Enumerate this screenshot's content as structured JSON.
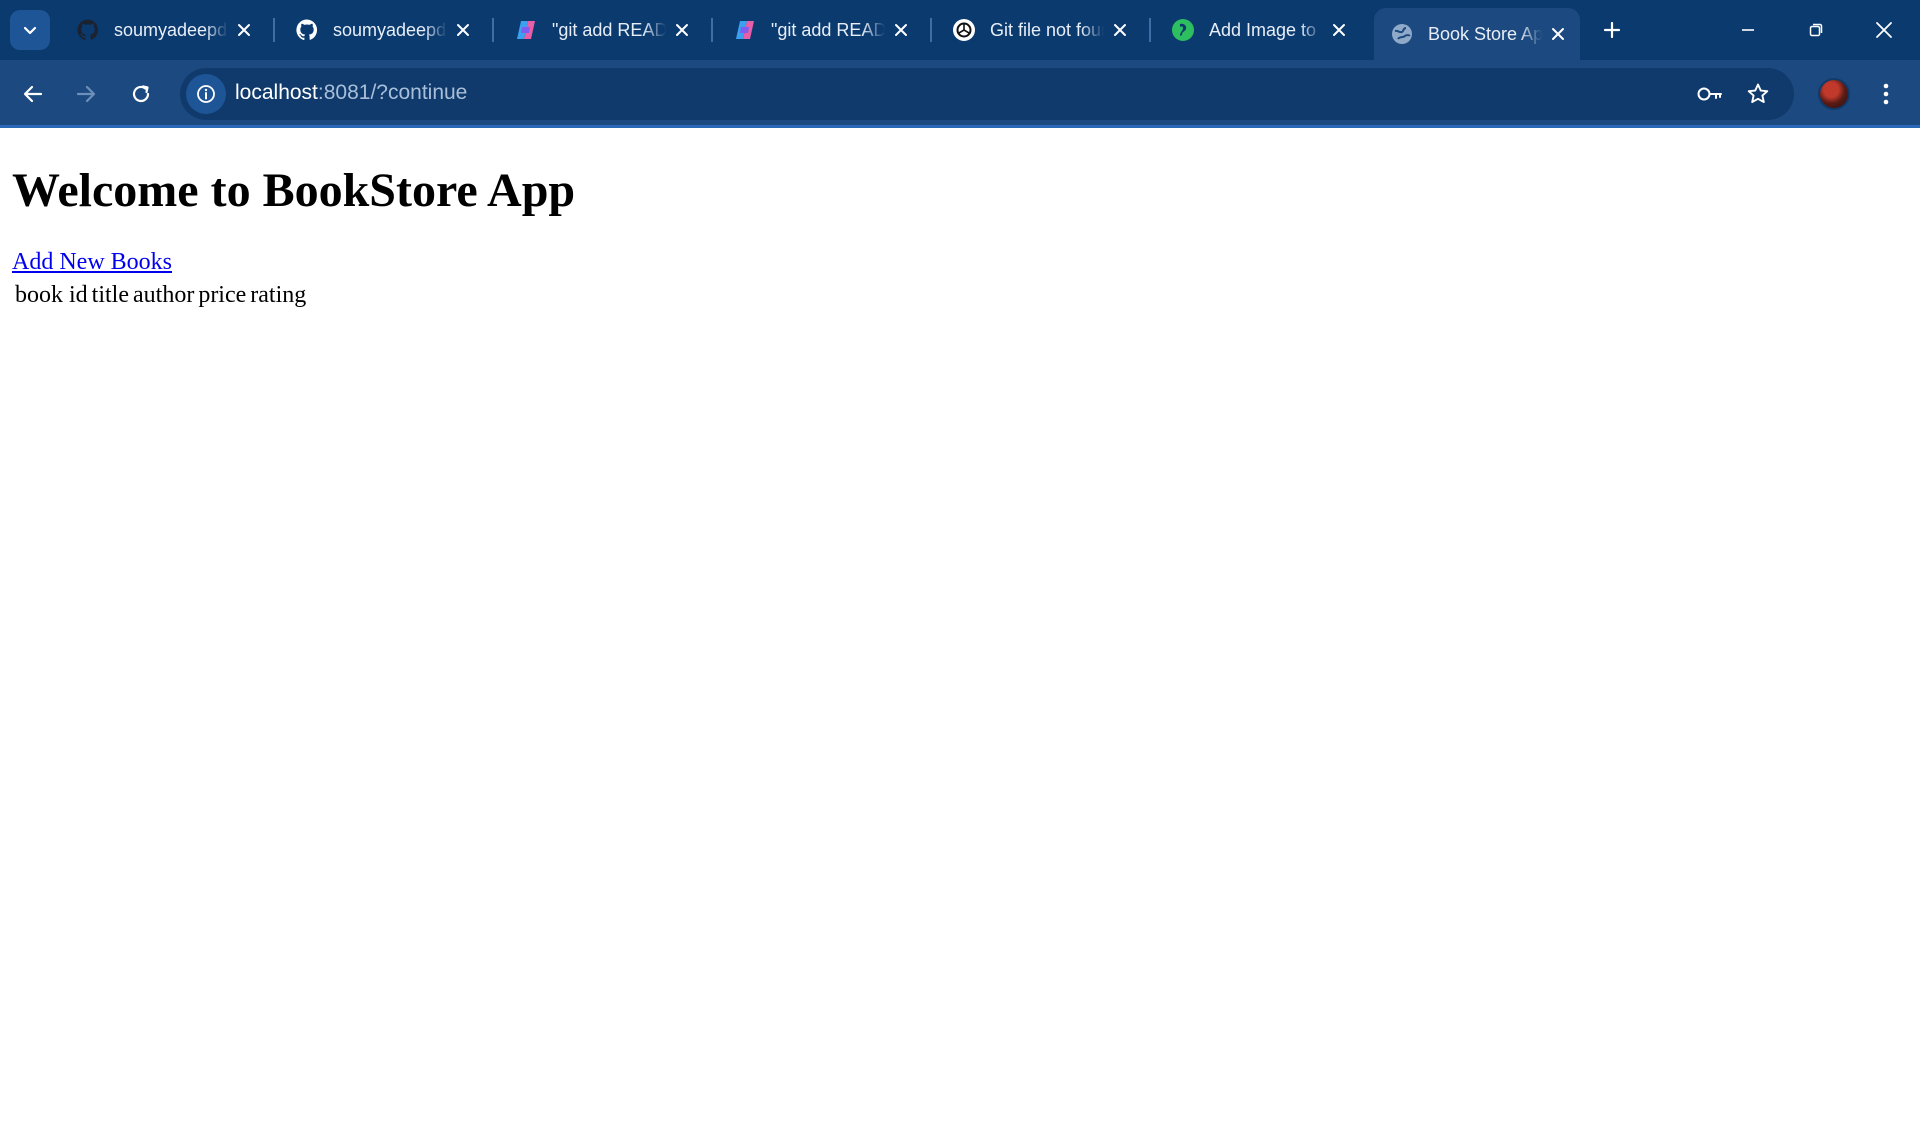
{
  "browser": {
    "tabs": [
      {
        "title": "soumyadeepdey",
        "favicon": "github-icon",
        "active": false
      },
      {
        "title": "soumyadeepdey",
        "favicon": "github-icon",
        "active": false
      },
      {
        "title": "\"git add README",
        "favicon": "copilot-icon",
        "active": false
      },
      {
        "title": "\"git add README",
        "favicon": "copilot-icon",
        "active": false
      },
      {
        "title": "Git file not found",
        "favicon": "chatgpt-icon",
        "active": false
      },
      {
        "title": "Add Image to",
        "favicon": "evernote-icon",
        "active": false
      },
      {
        "title": "Book Store App",
        "favicon": "globe-icon",
        "active": true
      }
    ],
    "address": {
      "host": "localhost",
      "rest": ":8081/?continue"
    },
    "colors": {
      "tabstrip": "#0b3a6f",
      "toolbar": "#1c4a80",
      "omnibox": "#0f3a6b"
    }
  },
  "page": {
    "heading": "Welcome to BookStore App",
    "add_link": "Add New Books",
    "table": {
      "headers": [
        "book id",
        "title",
        "author",
        "price",
        "rating"
      ]
    }
  }
}
